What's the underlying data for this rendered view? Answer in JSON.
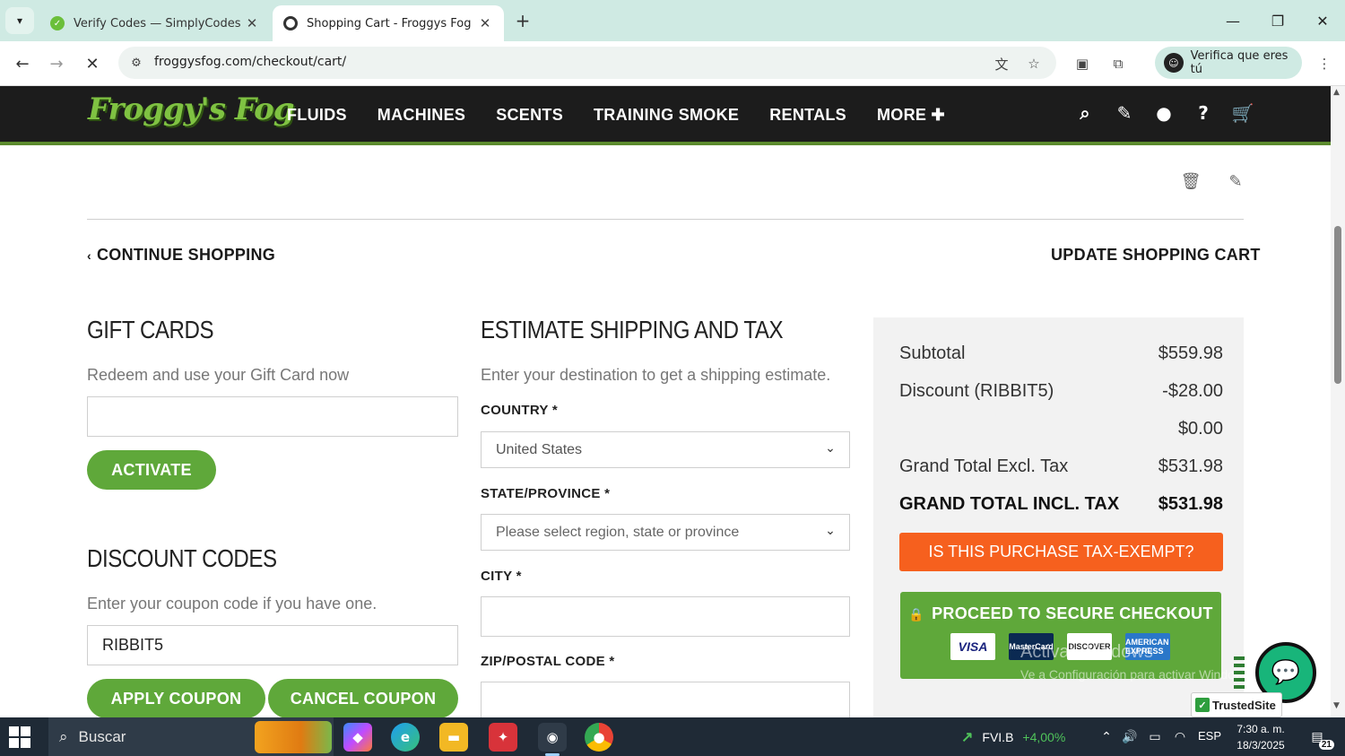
{
  "browser": {
    "tabs": [
      {
        "title": "Verify Codes — SimplyCodes",
        "active": false
      },
      {
        "title": "Shopping Cart - Froggys Fog",
        "active": true
      }
    ],
    "url": "froggysfog.com/checkout/cart/",
    "profile_label": "Verifica que eres tú"
  },
  "site": {
    "logo_text": "Froggy's Fog",
    "nav": [
      "FLUIDS",
      "MACHINES",
      "SCENTS",
      "TRAINING SMOKE",
      "RENTALS",
      "MORE ✚"
    ]
  },
  "cart": {
    "continue_label": "CONTINUE SHOPPING",
    "update_label": "UPDATE SHOPPING CART"
  },
  "gift_cards": {
    "title": "GIFT CARDS",
    "subtitle": "Redeem and use your Gift Card now",
    "input_value": "",
    "activate_label": "ACTIVATE"
  },
  "discount": {
    "title": "DISCOUNT CODES",
    "subtitle": "Enter your coupon code if you have one.",
    "input_value": "RIBBIT5",
    "apply_label": "APPLY COUPON",
    "cancel_label": "CANCEL COUPON"
  },
  "shipping": {
    "title": "ESTIMATE SHIPPING AND TAX",
    "subtitle": "Enter your destination to get a shipping estimate.",
    "country_label": "COUNTRY *",
    "country_value": "United States",
    "state_label": "STATE/PROVINCE *",
    "state_placeholder": "Please select region, state or province",
    "city_label": "CITY *",
    "city_value": "",
    "zip_label": "ZIP/POSTAL CODE *",
    "zip_value": ""
  },
  "summary": {
    "rows": [
      {
        "label": "Subtotal",
        "value": "$559.98"
      },
      {
        "label": "Discount (RIBBIT5)",
        "value": "-$28.00"
      },
      {
        "label": "",
        "value": "$0.00"
      },
      {
        "label": "Grand Total Excl. Tax",
        "value": "$531.98"
      },
      {
        "label": "GRAND TOTAL INCL. TAX",
        "value": "$531.98"
      }
    ],
    "tax_exempt_label": "IS THIS PURCHASE TAX-EXEMPT?",
    "checkout_label": "PROCEED TO SECURE CHECKOUT",
    "cards": [
      "VISA",
      "MasterCard",
      "DISCOVER",
      "AMERICAN EXPRESS"
    ]
  },
  "watermark": {
    "line1": "Activar Windows",
    "line2": "Ve a Configuración para activar Windows."
  },
  "trusted_site": "TrustedSite",
  "taskbar": {
    "search_label": "Buscar",
    "stock_symbol": "FVI.B",
    "stock_change": "+4,00%",
    "language": "ESP",
    "time": "7:30 a. m.",
    "date": "18/3/2025",
    "notifications": "21"
  },
  "colors": {
    "brand_green": "#5fa83a",
    "tax_orange": "#f6601e",
    "header_dark": "#1c1c1c"
  }
}
